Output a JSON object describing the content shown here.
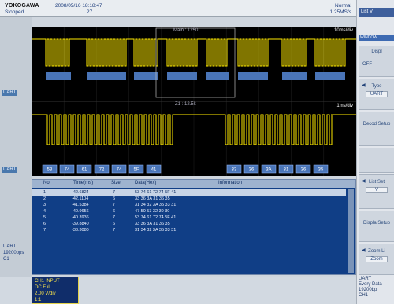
{
  "header": {
    "logo": "YOKOGAWA",
    "datetime": "2008/05/16 18:18:47",
    "status": "Stopped",
    "trigger_count": "27",
    "trigger_mode": "Normal",
    "sample_rate": "1.25MS/s"
  },
  "waveform": {
    "time_div_main": "10ms/div",
    "time_div_zoom": "1ms/div",
    "marker_main": "Main : 1250",
    "marker_zoom": "Z1 : 12.5k",
    "label_1": "UART",
    "label_2": "UART",
    "decoded_bytes": [
      "53",
      "74",
      "61",
      "72",
      "74",
      "5F",
      "41",
      "33",
      "36",
      "3A",
      "31",
      "36",
      "35"
    ]
  },
  "table": {
    "columns": [
      "No.",
      "Time(ms)",
      "Size",
      "Data(Hex)",
      "Information"
    ],
    "rows": [
      {
        "no": "1",
        "time": "-42.6824",
        "size": "7",
        "data": "53 74 61 72 74 5F 41"
      },
      {
        "no": "2",
        "time": "-42.1104",
        "size": "6",
        "data": "33 36 3A 31 36 35"
      },
      {
        "no": "3",
        "time": "-41.5384",
        "size": "7",
        "data": "31 34 32 3A 35 33 31"
      },
      {
        "no": "4",
        "time": "-40.9656",
        "size": "6",
        "data": "47 50 53 32 30 30"
      },
      {
        "no": "5",
        "time": "-40.3936",
        "size": "7",
        "data": "53 74 61 72 74 5F 41"
      },
      {
        "no": "6",
        "time": "-39.8840",
        "size": "6",
        "data": "33 36 3A 31 36 35"
      },
      {
        "no": "7",
        "time": "-38.3080",
        "size": "7",
        "data": "31 34 32 3A 35 33 31"
      }
    ]
  },
  "left_panel": {
    "uart_tag": "UART",
    "baud": "19200bps",
    "channel": "C1"
  },
  "channel_box": {
    "title": "CH1 INPUT",
    "coupling": "DC Full",
    "scale": "2.00 V/div",
    "probe": "1:1"
  },
  "menu": {
    "title": "List V",
    "window_label": "WINDOW",
    "display_label": "Displ",
    "display_value": "OFF",
    "type_label": "Type",
    "type_value": "UART",
    "decode_label": "Decod Setup",
    "list_setup_label": "List Set",
    "list_setup_value": "V",
    "display_setup_label": "Displa Setup",
    "zoom_label": "Zoom Li",
    "zoom_value": "Zoom"
  },
  "footer": {
    "line1": "UART",
    "line2": "Every Data",
    "line3": "19200bp",
    "line4": "CH1"
  },
  "colors": {
    "trace": "#ffea00",
    "packet": "#4a75b8",
    "table_bg": "#103e86"
  }
}
